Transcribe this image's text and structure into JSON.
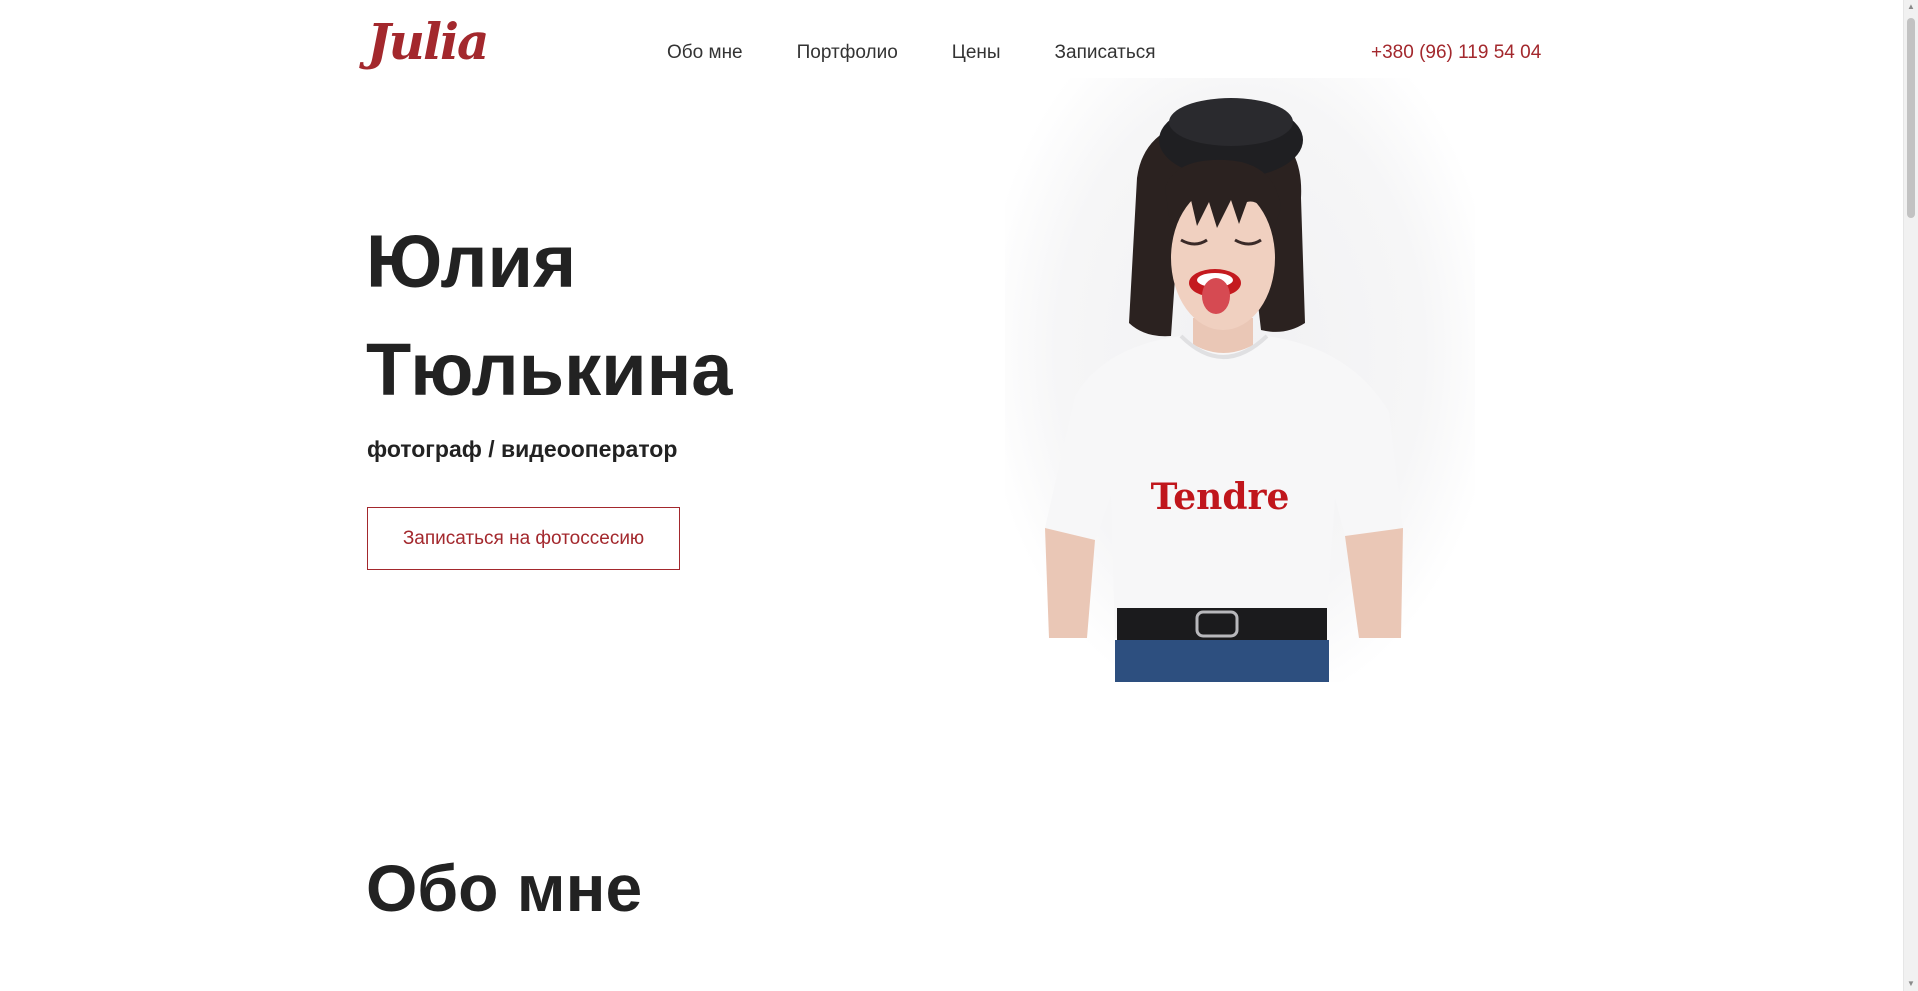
{
  "header": {
    "logo": "Julia",
    "nav": [
      "Обо мне",
      "Портфолио",
      "Цены",
      "Записаться"
    ],
    "phone": "+380 (96) 119 54 04"
  },
  "hero": {
    "name_line1": "Юлия",
    "name_line2": "Тюлькина",
    "subtitle": "фотограф / видеооператор",
    "cta": "Записаться на фотоссесию",
    "photo_shirt_text": "Tendre"
  },
  "about": {
    "title": "Обо мне"
  },
  "colors": {
    "accent": "#a3282d",
    "text": "#222222",
    "background": "#ffffff"
  },
  "icons": [
    "scroll-up-arrow-icon",
    "scroll-down-arrow-icon"
  ]
}
